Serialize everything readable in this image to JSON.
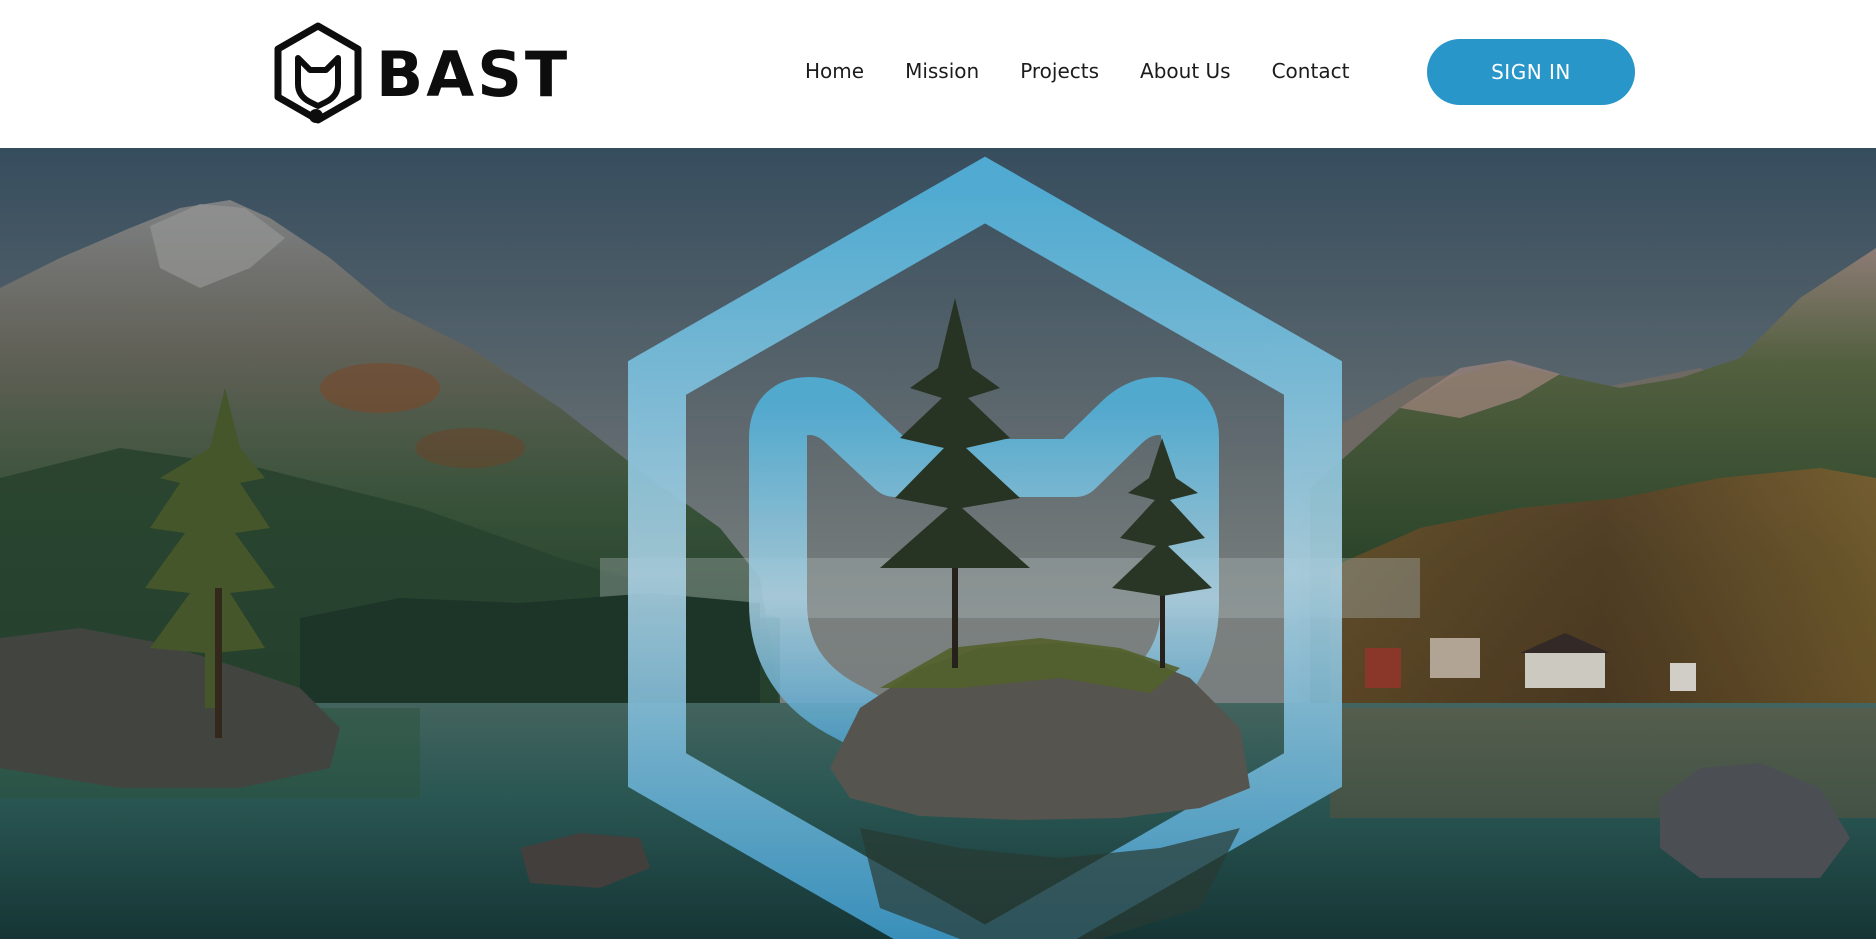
{
  "brand": {
    "name": "BAST",
    "logo_icon": "hex-cat-icon"
  },
  "nav": {
    "items": [
      {
        "label": "Home"
      },
      {
        "label": "Mission"
      },
      {
        "label": "Projects"
      },
      {
        "label": "About Us"
      },
      {
        "label": "Contact"
      }
    ]
  },
  "signin": {
    "label": "SIGN IN"
  },
  "hero": {
    "image": "mountain-lake-landscape",
    "emblem_icon": "hex-cat-icon"
  },
  "colors": {
    "accent": "#2896c8",
    "emblem": "#5cc8f5",
    "logo": "#0d0d0d",
    "nav_text": "#1c1c1c"
  }
}
